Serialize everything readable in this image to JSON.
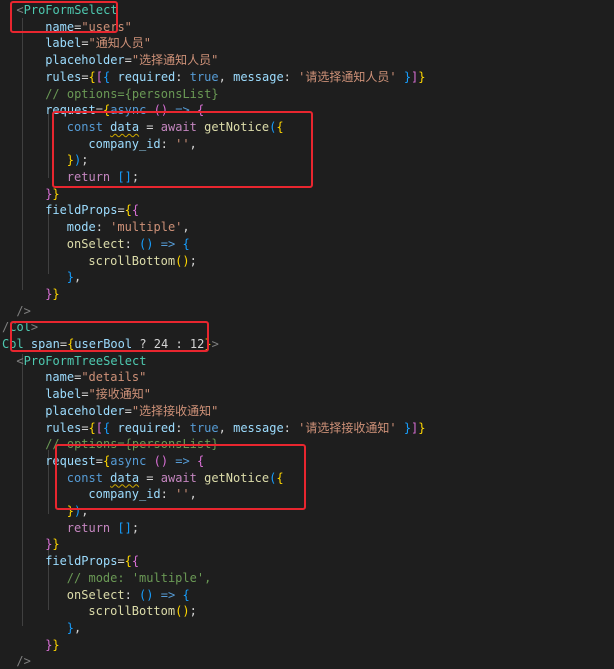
{
  "editor": {
    "language": "jsx",
    "theme": {
      "background": "#1e1e1e",
      "highlight_box": "#e8262f",
      "tag": "#4ec9b0",
      "attribute": "#9cdcfe",
      "string": "#ce9178",
      "keyword": "#569cd6",
      "control": "#c586c0",
      "function": "#dcdcaa",
      "comment": "#6a9955",
      "warning_squiggle": "#cca700"
    },
    "lines": [
      {
        "indent": 2,
        "tokens": [
          [
            "t-punct",
            "<"
          ],
          [
            "t-tag",
            "ProFormSelect"
          ]
        ]
      },
      {
        "indent": 6,
        "tokens": [
          [
            "t-attr",
            "name"
          ],
          [
            "t-plain",
            "="
          ],
          [
            "t-string",
            "\"users\""
          ]
        ]
      },
      {
        "indent": 6,
        "tokens": [
          [
            "t-attr",
            "label"
          ],
          [
            "t-plain",
            "="
          ],
          [
            "t-string",
            "\"通知人员\""
          ]
        ]
      },
      {
        "indent": 6,
        "tokens": [
          [
            "t-attr",
            "placeholder"
          ],
          [
            "t-plain",
            "="
          ],
          [
            "t-string",
            "\"选择通知人员\""
          ]
        ]
      },
      {
        "indent": 6,
        "tokens": [
          [
            "t-attr",
            "rules"
          ],
          [
            "t-plain",
            "="
          ],
          [
            "t-brace-y",
            "{"
          ],
          [
            "t-brace-p",
            "["
          ],
          [
            "t-brace-b",
            "{"
          ],
          [
            "t-plain",
            " "
          ],
          [
            "t-attr",
            "required"
          ],
          [
            "t-plain",
            ": "
          ],
          [
            "t-keyword",
            "true"
          ],
          [
            "t-plain",
            ", "
          ],
          [
            "t-attr",
            "message"
          ],
          [
            "t-plain",
            ": "
          ],
          [
            "t-string",
            "'请选择通知人员'"
          ],
          [
            "t-plain",
            " "
          ],
          [
            "t-brace-b",
            "}"
          ],
          [
            "t-brace-p",
            "]"
          ],
          [
            "t-brace-y",
            "}"
          ]
        ]
      },
      {
        "indent": 6,
        "tokens": [
          [
            "t-comment",
            "// options={personsList}"
          ]
        ]
      },
      {
        "indent": 6,
        "tokens": [
          [
            "t-attr",
            "request"
          ],
          [
            "t-plain",
            "="
          ],
          [
            "t-brace-y",
            "{"
          ],
          [
            "t-keyword",
            "async"
          ],
          [
            "t-plain",
            " "
          ],
          [
            "t-brace-p",
            "("
          ],
          [
            "t-brace-p",
            ")"
          ],
          [
            "t-plain",
            " "
          ],
          [
            "t-keyword",
            "=>"
          ],
          [
            "t-plain",
            " "
          ],
          [
            "t-brace-p",
            "{"
          ]
        ]
      },
      {
        "indent": 9,
        "tokens": [
          [
            "t-keyword",
            "const"
          ],
          [
            "t-plain",
            " "
          ],
          [
            "t-attr squiggle",
            "data"
          ],
          [
            "t-plain",
            " = "
          ],
          [
            "t-control",
            "await"
          ],
          [
            "t-plain",
            " "
          ],
          [
            "t-func",
            "getNotice"
          ],
          [
            "t-brace-b",
            "("
          ],
          [
            "t-brace-y",
            "{"
          ]
        ]
      },
      {
        "indent": 12,
        "tokens": [
          [
            "t-attr",
            "company_id"
          ],
          [
            "t-plain",
            ": "
          ],
          [
            "t-string",
            "''"
          ],
          [
            "t-plain",
            ","
          ]
        ]
      },
      {
        "indent": 9,
        "tokens": [
          [
            "t-brace-y",
            "}"
          ],
          [
            "t-brace-b",
            ")"
          ],
          [
            "t-plain",
            ";"
          ]
        ]
      },
      {
        "indent": 9,
        "tokens": [
          [
            "t-control",
            "return"
          ],
          [
            "t-plain",
            " "
          ],
          [
            "t-brace-b",
            "["
          ],
          [
            "t-brace-b",
            "]"
          ],
          [
            "t-plain",
            ";"
          ]
        ]
      },
      {
        "indent": 6,
        "tokens": [
          [
            "t-brace-p",
            "}"
          ],
          [
            "t-brace-y",
            "}"
          ]
        ]
      },
      {
        "indent": 6,
        "tokens": [
          [
            "t-attr",
            "fieldProps"
          ],
          [
            "t-plain",
            "="
          ],
          [
            "t-brace-y",
            "{"
          ],
          [
            "t-brace-p",
            "{"
          ]
        ]
      },
      {
        "indent": 9,
        "tokens": [
          [
            "t-attr",
            "mode"
          ],
          [
            "t-plain",
            ": "
          ],
          [
            "t-string",
            "'multiple'"
          ],
          [
            "t-plain",
            ","
          ]
        ]
      },
      {
        "indent": 9,
        "tokens": [
          [
            "t-func",
            "onSelect"
          ],
          [
            "t-plain",
            ": "
          ],
          [
            "t-brace-b",
            "("
          ],
          [
            "t-brace-b",
            ")"
          ],
          [
            "t-plain",
            " "
          ],
          [
            "t-keyword",
            "=>"
          ],
          [
            "t-plain",
            " "
          ],
          [
            "t-brace-b",
            "{"
          ]
        ]
      },
      {
        "indent": 12,
        "tokens": [
          [
            "t-func",
            "scrollBottom"
          ],
          [
            "t-brace-y",
            "("
          ],
          [
            "t-brace-y",
            ")"
          ],
          [
            "t-plain",
            ";"
          ]
        ]
      },
      {
        "indent": 9,
        "tokens": [
          [
            "t-brace-b",
            "}"
          ],
          [
            "t-plain",
            ","
          ]
        ]
      },
      {
        "indent": 6,
        "tokens": [
          [
            "t-brace-p",
            "}"
          ],
          [
            "t-brace-y",
            "}"
          ]
        ]
      },
      {
        "indent": 2,
        "tokens": [
          [
            "t-punct",
            "/>"
          ]
        ]
      },
      {
        "indent": 0,
        "tokens": [
          [
            "t-punct",
            "/"
          ],
          [
            "t-tag",
            "Col"
          ],
          [
            "t-punct",
            ">"
          ]
        ]
      },
      {
        "indent": 0,
        "tokens": [
          [
            "t-tag",
            "Col"
          ],
          [
            "t-plain",
            " "
          ],
          [
            "t-attr",
            "span"
          ],
          [
            "t-plain",
            "="
          ],
          [
            "t-brace-y",
            "{"
          ],
          [
            "t-attr",
            "userBool"
          ],
          [
            "t-plain",
            " ? "
          ],
          [
            "t-plain",
            "24"
          ],
          [
            "t-plain",
            " : "
          ],
          [
            "t-plain",
            "12"
          ],
          [
            "t-brace-y",
            "}"
          ],
          [
            "t-punct",
            ">"
          ]
        ]
      },
      {
        "indent": 2,
        "tokens": [
          [
            "t-punct",
            "<"
          ],
          [
            "t-tag",
            "ProFormTreeSelect"
          ]
        ]
      },
      {
        "indent": 6,
        "tokens": [
          [
            "t-attr",
            "name"
          ],
          [
            "t-plain",
            "="
          ],
          [
            "t-string",
            "\"details\""
          ]
        ]
      },
      {
        "indent": 6,
        "tokens": [
          [
            "t-attr",
            "label"
          ],
          [
            "t-plain",
            "="
          ],
          [
            "t-string",
            "\"接收通知\""
          ]
        ]
      },
      {
        "indent": 6,
        "tokens": [
          [
            "t-attr",
            "placeholder"
          ],
          [
            "t-plain",
            "="
          ],
          [
            "t-string",
            "\"选择接收通知\""
          ]
        ]
      },
      {
        "indent": 6,
        "tokens": [
          [
            "t-attr",
            "rules"
          ],
          [
            "t-plain",
            "="
          ],
          [
            "t-brace-y",
            "{"
          ],
          [
            "t-brace-p",
            "["
          ],
          [
            "t-brace-b",
            "{"
          ],
          [
            "t-plain",
            " "
          ],
          [
            "t-attr",
            "required"
          ],
          [
            "t-plain",
            ": "
          ],
          [
            "t-keyword",
            "true"
          ],
          [
            "t-plain",
            ", "
          ],
          [
            "t-attr",
            "message"
          ],
          [
            "t-plain",
            ": "
          ],
          [
            "t-string",
            "'请选择接收通知'"
          ],
          [
            "t-plain",
            " "
          ],
          [
            "t-brace-b",
            "}"
          ],
          [
            "t-brace-p",
            "]"
          ],
          [
            "t-brace-y",
            "}"
          ]
        ]
      },
      {
        "indent": 6,
        "tokens": [
          [
            "t-comment",
            "// options={personsList}"
          ]
        ]
      },
      {
        "indent": 6,
        "tokens": [
          [
            "t-attr",
            "request"
          ],
          [
            "t-plain",
            "="
          ],
          [
            "t-brace-y",
            "{"
          ],
          [
            "t-keyword",
            "async"
          ],
          [
            "t-plain",
            " "
          ],
          [
            "t-brace-p",
            "("
          ],
          [
            "t-brace-p",
            ")"
          ],
          [
            "t-plain",
            " "
          ],
          [
            "t-keyword",
            "=>"
          ],
          [
            "t-plain",
            " "
          ],
          [
            "t-brace-p",
            "{"
          ]
        ]
      },
      {
        "indent": 9,
        "tokens": [
          [
            "t-keyword",
            "const"
          ],
          [
            "t-plain",
            " "
          ],
          [
            "t-attr squiggle",
            "data"
          ],
          [
            "t-plain",
            " = "
          ],
          [
            "t-control",
            "await"
          ],
          [
            "t-plain",
            " "
          ],
          [
            "t-func",
            "getNotice"
          ],
          [
            "t-brace-b",
            "("
          ],
          [
            "t-brace-y",
            "{"
          ]
        ]
      },
      {
        "indent": 12,
        "tokens": [
          [
            "t-attr",
            "company_id"
          ],
          [
            "t-plain",
            ": "
          ],
          [
            "t-string",
            "''"
          ],
          [
            "t-plain",
            ","
          ]
        ]
      },
      {
        "indent": 9,
        "tokens": [
          [
            "t-brace-y",
            "}"
          ],
          [
            "t-brace-b",
            ")"
          ],
          [
            "t-plain",
            ";"
          ]
        ]
      },
      {
        "indent": 9,
        "tokens": [
          [
            "t-control",
            "return"
          ],
          [
            "t-plain",
            " "
          ],
          [
            "t-brace-b",
            "["
          ],
          [
            "t-brace-b",
            "]"
          ],
          [
            "t-plain",
            ";"
          ]
        ]
      },
      {
        "indent": 6,
        "tokens": [
          [
            "t-brace-p",
            "}"
          ],
          [
            "t-brace-y",
            "}"
          ]
        ]
      },
      {
        "indent": 6,
        "tokens": [
          [
            "t-attr",
            "fieldProps"
          ],
          [
            "t-plain",
            "="
          ],
          [
            "t-brace-y",
            "{"
          ],
          [
            "t-brace-p",
            "{"
          ]
        ]
      },
      {
        "indent": 9,
        "tokens": [
          [
            "t-comment",
            "// mode: 'multiple',"
          ]
        ]
      },
      {
        "indent": 9,
        "tokens": [
          [
            "t-func",
            "onSelect"
          ],
          [
            "t-plain",
            ": "
          ],
          [
            "t-brace-b",
            "("
          ],
          [
            "t-brace-b",
            ")"
          ],
          [
            "t-plain",
            " "
          ],
          [
            "t-keyword",
            "=>"
          ],
          [
            "t-plain",
            " "
          ],
          [
            "t-brace-b",
            "{"
          ]
        ]
      },
      {
        "indent": 12,
        "tokens": [
          [
            "t-func",
            "scrollBottom"
          ],
          [
            "t-brace-y",
            "("
          ],
          [
            "t-brace-y",
            ")"
          ],
          [
            "t-plain",
            ";"
          ]
        ]
      },
      {
        "indent": 9,
        "tokens": [
          [
            "t-brace-b",
            "}"
          ],
          [
            "t-plain",
            ","
          ]
        ]
      },
      {
        "indent": 6,
        "tokens": [
          [
            "t-brace-p",
            "}"
          ],
          [
            "t-brace-y",
            "}"
          ]
        ]
      },
      {
        "indent": 2,
        "tokens": [
          [
            "t-punct",
            "/>"
          ]
        ]
      }
    ]
  }
}
